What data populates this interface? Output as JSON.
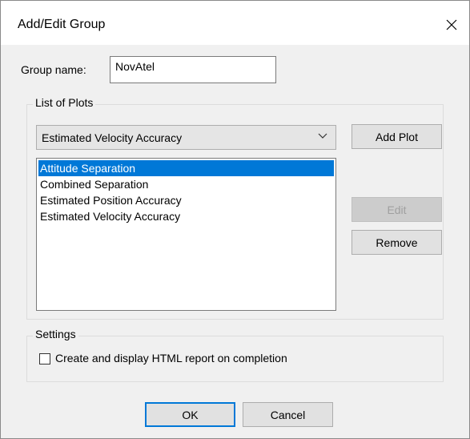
{
  "window": {
    "title": "Add/Edit Group",
    "close_icon": "close-icon"
  },
  "group_name": {
    "label": "Group name:",
    "value": "NovAtel"
  },
  "plots": {
    "section_title": "List of Plots",
    "combo_selected": "Estimated Velocity Accuracy",
    "items": [
      "Attitude Separation",
      "Combined Separation",
      "Estimated Position Accuracy",
      "Estimated Velocity Accuracy"
    ],
    "selected_index": 0,
    "add_label": "Add Plot",
    "edit_label": "Edit",
    "remove_label": "Remove"
  },
  "settings": {
    "section_title": "Settings",
    "checkbox_label": "Create and display HTML report on completion",
    "checked": false
  },
  "footer": {
    "ok_label": "OK",
    "cancel_label": "Cancel"
  },
  "colors": {
    "selection": "#0078d7",
    "dialog_bg": "#f0f0f0"
  }
}
